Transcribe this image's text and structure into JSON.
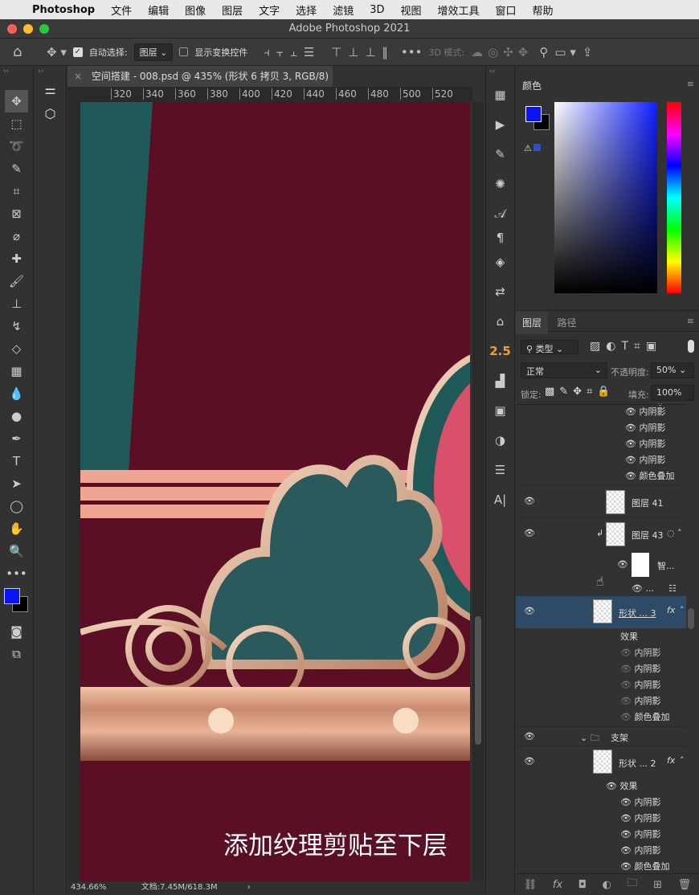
{
  "menubar": {
    "apple": "",
    "app": "Photoshop",
    "items": [
      "文件",
      "编辑",
      "图像",
      "图层",
      "文字",
      "选择",
      "滤镜",
      "3D",
      "视图",
      "增效工具",
      "窗口",
      "帮助"
    ]
  },
  "window": {
    "title": "Adobe Photoshop 2021"
  },
  "options": {
    "auto_select_label": "自动选择:",
    "auto_select_checked": true,
    "auto_select_value": "图层",
    "show_transform_label": "显示变换控件",
    "show_transform_checked": false,
    "mode_3d": "3D 模式:"
  },
  "document": {
    "tab_title": "空间搭建 - 008.psd @ 435% (形状 6 拷贝 3, RGB/8) *",
    "ruler_ticks": [
      "320",
      "340",
      "360",
      "380",
      "400",
      "420",
      "440",
      "460",
      "480",
      "500",
      "520"
    ],
    "caption": "添加纹理剪贴至下层"
  },
  "status": {
    "zoom": "434.66%",
    "doc": "文档:7.45M/618.3M"
  },
  "iconcol": {
    "value_label": "2.5"
  },
  "color_panel": {
    "tab": "颜色",
    "foreground": "#0a14f5",
    "background": "#000000"
  },
  "layers_panel": {
    "tabs": [
      "图层",
      "路径"
    ],
    "filter": "类型",
    "blend_mode": "正常",
    "opacity_label": "不透明度:",
    "opacity": "50%",
    "lock_label": "锁定:",
    "fill_label": "填充:",
    "fill": "100%",
    "top_effects": [
      "内阴影",
      "内阴影",
      "内阴影",
      "内阴影",
      "颜色叠加"
    ],
    "layer41": "图层 41",
    "layer43": "图层 43",
    "smart_filter": "智...",
    "filter_more": "...",
    "shape3": "形状 ... 3",
    "effects_label": "效果",
    "shape3_effects": [
      "内阴影",
      "内阴影",
      "内阴影",
      "内阴影",
      "颜色叠加"
    ],
    "group": "支架",
    "shape2": "形状 ... 2",
    "shape2_effects": [
      "内阴影",
      "内阴影",
      "内阴影",
      "内阴影",
      "颜色叠加"
    ],
    "fx": "fx"
  },
  "colors": {
    "accent_selected": "#2d4a66",
    "canvas_bg": "#5a0f24"
  }
}
